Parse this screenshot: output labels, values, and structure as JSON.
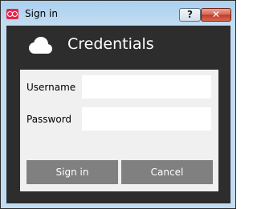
{
  "window": {
    "title": "Sign in",
    "help_button": "?",
    "close_button": "✕"
  },
  "header": {
    "title": "Credentials"
  },
  "form": {
    "username_label": "Username",
    "username_value": "",
    "password_label": "Password",
    "password_value": ""
  },
  "buttons": {
    "signin_label": "Sign in",
    "cancel_label": "Cancel"
  },
  "colors": {
    "dialog_background": "#2d2d2d",
    "form_panel": "#f0f0f0",
    "button_background": "#808080",
    "app_icon": "#e6264a"
  },
  "icons": {
    "app": "app-logo-icon",
    "header": "cloud-icon"
  }
}
